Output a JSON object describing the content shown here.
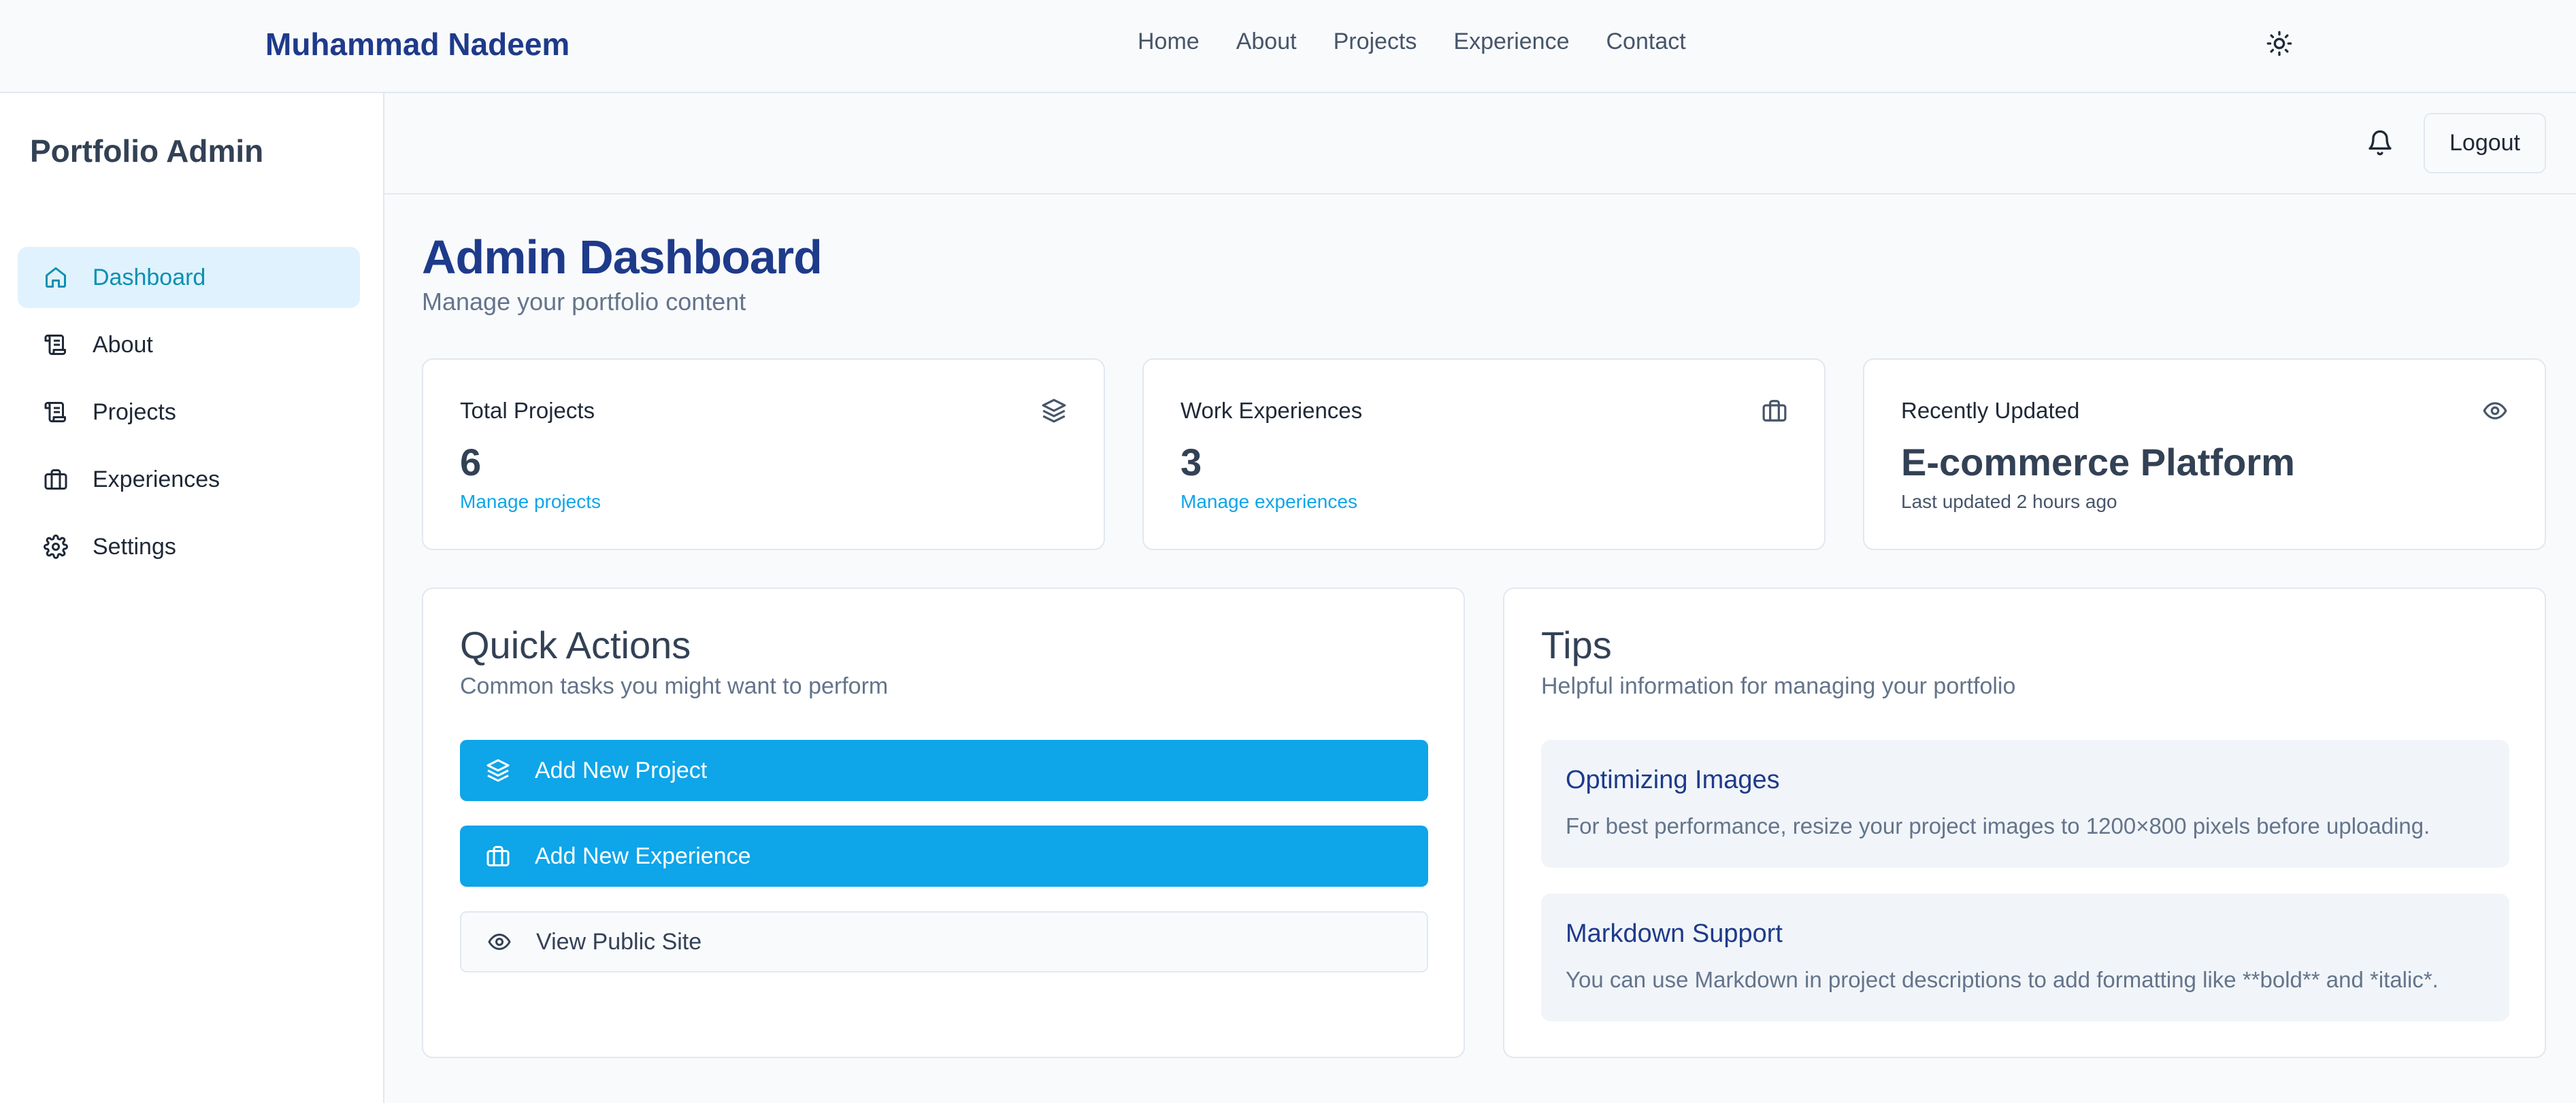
{
  "topnav": {
    "brand": "Muhammad Nadeem",
    "links": [
      "Home",
      "About",
      "Projects",
      "Experience",
      "Contact"
    ],
    "theme_icon": "sun-icon"
  },
  "sidebar": {
    "title": "Portfolio Admin",
    "items": [
      {
        "label": "Dashboard",
        "icon": "home-icon",
        "active": true
      },
      {
        "label": "About",
        "icon": "scroll-icon",
        "active": false
      },
      {
        "label": "Projects",
        "icon": "scroll-icon",
        "active": false
      },
      {
        "label": "Experiences",
        "icon": "briefcase-icon",
        "active": false
      },
      {
        "label": "Settings",
        "icon": "gear-icon",
        "active": false
      }
    ]
  },
  "header": {
    "bell_icon": "bell-icon",
    "logout_label": "Logout"
  },
  "page": {
    "title": "Admin Dashboard",
    "subtitle": "Manage your portfolio content"
  },
  "stats": [
    {
      "label": "Total Projects",
      "value": "6",
      "link": "Manage projects",
      "icon": "layers-icon"
    },
    {
      "label": "Work Experiences",
      "value": "3",
      "link": "Manage experiences",
      "icon": "briefcase-icon"
    },
    {
      "label": "Recently Updated",
      "value": "E-commerce Platform",
      "note": "Last updated 2 hours ago",
      "icon": "eye-icon"
    }
  ],
  "quick_actions": {
    "title": "Quick Actions",
    "subtitle": "Common tasks you might want to perform",
    "buttons": [
      {
        "label": "Add New Project",
        "icon": "layers-icon"
      },
      {
        "label": "Add New Experience",
        "icon": "briefcase-icon"
      },
      {
        "label": "View Public Site",
        "icon": "eye-icon"
      }
    ]
  },
  "tips": {
    "title": "Tips",
    "subtitle": "Helpful information for managing your portfolio",
    "items": [
      {
        "title": "Optimizing Images",
        "text": "For best performance, resize your project images to 1200×800 pixels before uploading."
      },
      {
        "title": "Markdown Support",
        "text": "You can use Markdown in project descriptions to add formatting like **bold** and *italic*."
      }
    ]
  },
  "colors": {
    "brand": "#1e3a8a",
    "accent": "#0ea5e9",
    "active_bg": "#e0f2fe",
    "border": "#e2e8f0"
  }
}
